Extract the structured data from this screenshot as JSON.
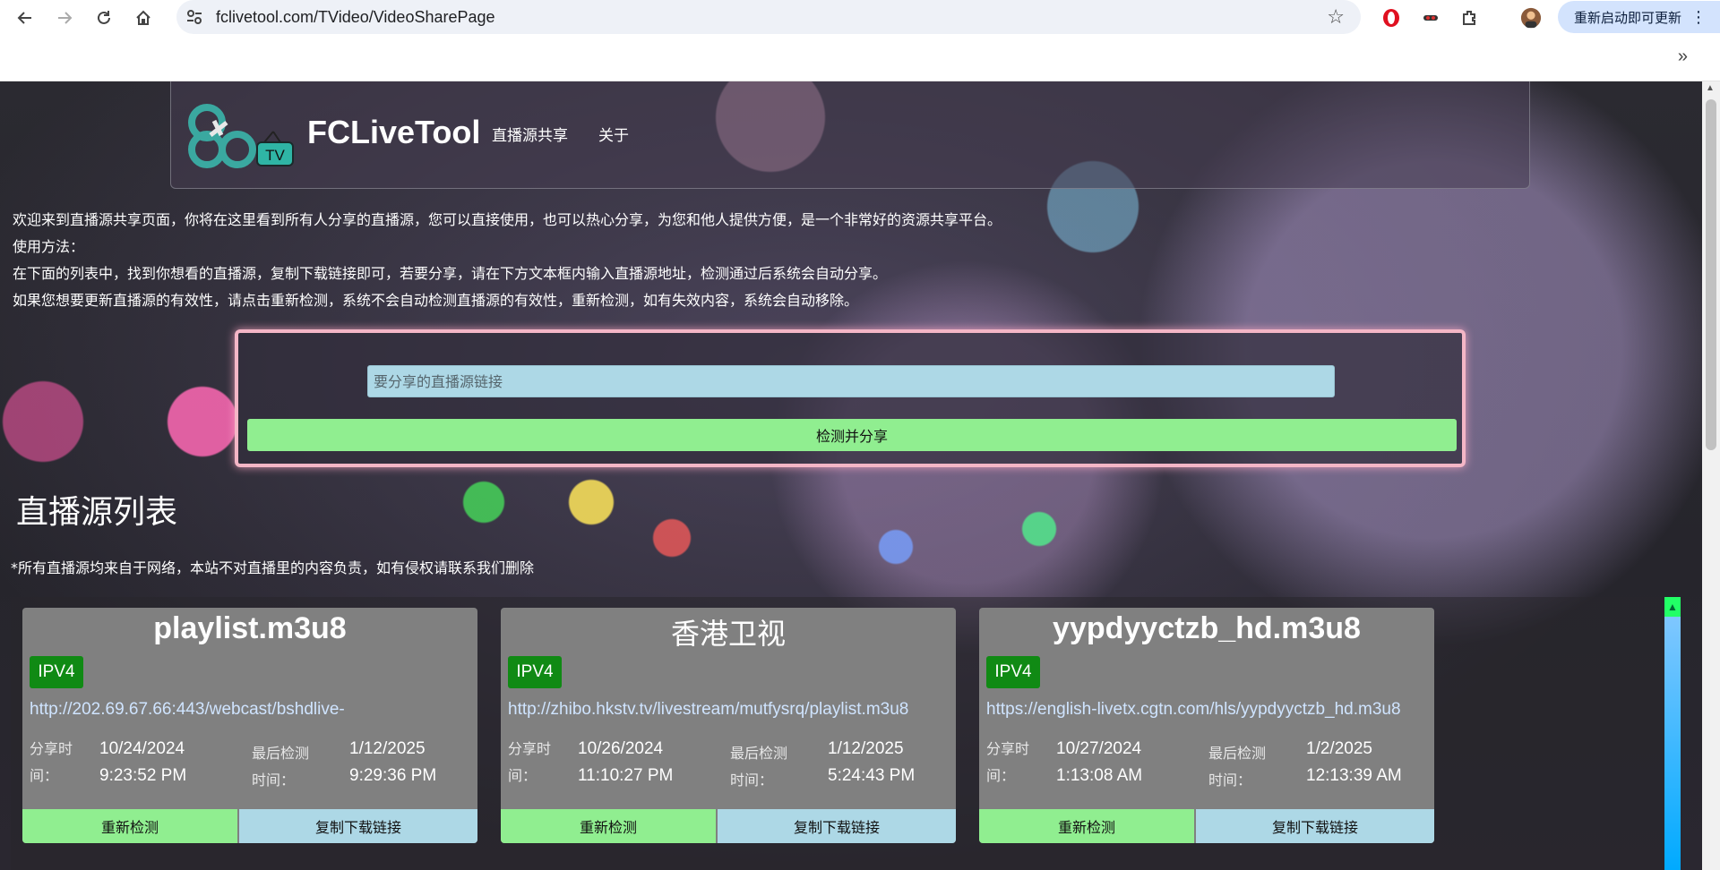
{
  "browser": {
    "url": "fclivetool.com/TVideo/VideoSharePage",
    "update_label": "重新启动即可更新",
    "more_bookmarks": "»"
  },
  "header": {
    "logo_tv": "TV",
    "brand": "FCLiveTool",
    "nav": [
      "直播源共享",
      "关于"
    ]
  },
  "intro": [
    "欢迎来到直播源共享页面，你将在这里看到所有人分享的直播源，您可以直接使用，也可以热心分享，为您和他人提供方便，是一个非常好的资源共享平台。",
    "使用方法：",
    "在下面的列表中，找到你想看的直播源，复制下载链接即可，若要分享，请在下方文本框内输入直播源地址，检测通过后系统会自动分享。",
    "如果您想要更新直播源的有效性，请点击重新检测，系统不会自动检测直播源的有效性，重新检测，如有失效内容，系统会自动移除。"
  ],
  "share": {
    "placeholder": "要分享的直播源链接",
    "button": "检测并分享"
  },
  "list_title": "直播源列表",
  "disclaimer": "*所有直播源均来自于网络，本站不对直播里的内容负责，如有侵权请联系我们删除",
  "labels": {
    "share_time_1": "分享时",
    "share_time_2": "间：",
    "check_time_1": "最后检测",
    "check_time_2": "时间：",
    "recheck": "重新检测",
    "copy": "复制下载链接"
  },
  "cards": [
    {
      "title": "playlist.m3u8",
      "badge": "IPV4",
      "url": "http://202.69.67.66:443/webcast/bshdlive-",
      "share_date": "10/24/2024",
      "share_time": "9:23:52 PM",
      "check_date": "1/12/2025",
      "check_time": "9:29:36 PM"
    },
    {
      "title": "香港卫视",
      "badge": "IPV4",
      "url": "http://zhibo.hkstv.tv/livestream/mutfysrq/playlist.m3u8",
      "share_date": "10/26/2024",
      "share_time": "11:10:27 PM",
      "check_date": "1/12/2025",
      "check_time": "5:24:43 PM"
    },
    {
      "title": "yypdyyctzb_hd.m3u8",
      "badge": "IPV4",
      "url": "https://english-livetx.cgtn.com/hls/yypdyyctzb_hd.m3u8",
      "share_date": "10/27/2024",
      "share_time": "1:13:08 AM",
      "check_date": "1/2/2025",
      "check_time": "12:13:39 AM"
    }
  ],
  "colors": {
    "recheck_button": "#90ee90",
    "copy_button": "#add8e6",
    "badge": "#108a14",
    "card": "#808080",
    "share_border": "#f4b6c6"
  }
}
